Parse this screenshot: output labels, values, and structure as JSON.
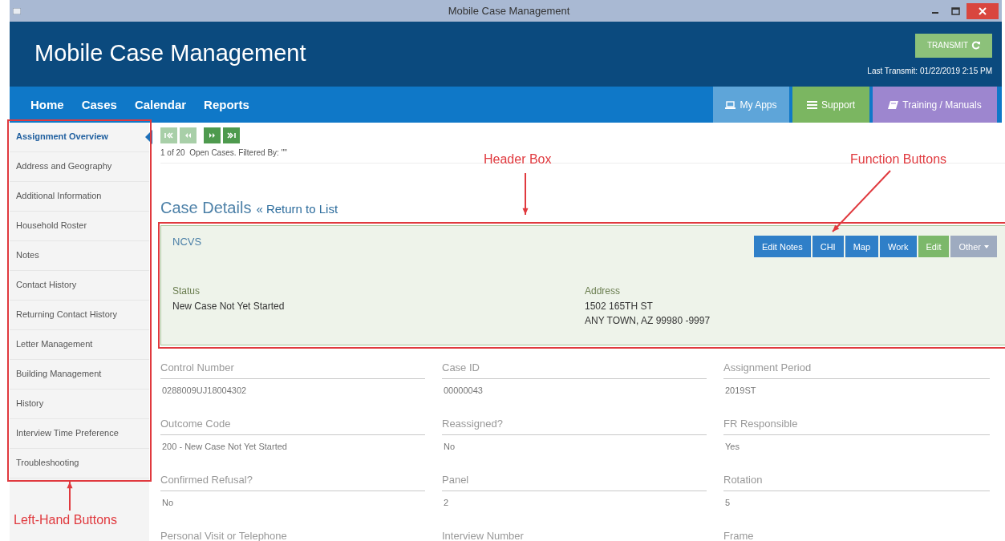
{
  "window": {
    "title": "Mobile Case Management"
  },
  "header": {
    "title": "Mobile Case Management",
    "transmit_button": "TRANSMIT",
    "last_transmit": "Last Transmit: 01/22/2019 2:15 PM"
  },
  "nav": {
    "links": [
      "Home",
      "Cases",
      "Calendar",
      "Reports"
    ],
    "apps": [
      {
        "label": "My Apps",
        "kind": "laptop",
        "color": "#5ea5d9"
      },
      {
        "label": "Support",
        "kind": "list",
        "color": "#7bb661"
      },
      {
        "label": "Training / Manuals",
        "kind": "book",
        "color": "#9d86cf"
      }
    ]
  },
  "sidebar": {
    "items": [
      {
        "label": "Assignment Overview",
        "selected": true
      },
      {
        "label": "Address and Geography",
        "selected": false
      },
      {
        "label": "Additional Information",
        "selected": false
      },
      {
        "label": "Household Roster",
        "selected": false
      },
      {
        "label": "Notes",
        "selected": false
      },
      {
        "label": "Contact History",
        "selected": false
      },
      {
        "label": "Returning Contact History",
        "selected": false
      },
      {
        "label": "Letter Management",
        "selected": false
      },
      {
        "label": "Building Management",
        "selected": false
      },
      {
        "label": "History",
        "selected": false
      },
      {
        "label": "Interview Time Preference",
        "selected": false
      },
      {
        "label": "Troubleshooting",
        "selected": false
      }
    ]
  },
  "pager": {
    "buttons": [
      {
        "kind": "first",
        "disabled": true
      },
      {
        "kind": "previous",
        "disabled": true
      },
      {
        "kind": "next",
        "disabled": false
      },
      {
        "kind": "last",
        "disabled": false
      }
    ],
    "status": "1 of 20  Open Cases. Filtered By: \"\""
  },
  "case": {
    "heading": "Case Details",
    "return_link": "« Return to List",
    "program": "NCVS",
    "function_buttons": [
      {
        "label": "Edit Notes",
        "kind": "primary"
      },
      {
        "label": "CHI",
        "kind": "primary"
      },
      {
        "label": "Map",
        "kind": "primary"
      },
      {
        "label": "Work",
        "kind": "primary"
      },
      {
        "label": "Edit",
        "kind": "success"
      },
      {
        "label": "Other",
        "kind": "dropdown"
      }
    ],
    "status_label": "Status",
    "status": "New Case Not Yet Started",
    "address_label": "Address",
    "address_lines": [
      "1502 165TH ST",
      "ANY TOWN, AZ 99980 -9997"
    ]
  },
  "fields": [
    {
      "label": "Control Number",
      "value": "0288009UJ18004302"
    },
    {
      "label": "Case ID",
      "value": "00000043"
    },
    {
      "label": "Assignment Period",
      "value": "2019ST"
    },
    {
      "label": "Outcome Code",
      "value": "200 - New Case Not Yet Started"
    },
    {
      "label": "Reassigned?",
      "value": "No"
    },
    {
      "label": "FR Responsible",
      "value": "Yes"
    },
    {
      "label": "Confirmed Refusal?",
      "value": "No"
    },
    {
      "label": "Panel",
      "value": "2"
    },
    {
      "label": "Rotation",
      "value": "5"
    },
    {
      "label": "Personal Visit or Telephone"
    },
    {
      "label": "Interview Number"
    },
    {
      "label": "Frame"
    }
  ],
  "annotations": [
    {
      "kind": "box"
    },
    {
      "kind": "box"
    },
    {
      "kind": "callout",
      "text": "Header Box"
    },
    {
      "kind": "callout",
      "text": "Function Buttons"
    },
    {
      "kind": "callout",
      "text": "Left-Hand Buttons"
    }
  ]
}
